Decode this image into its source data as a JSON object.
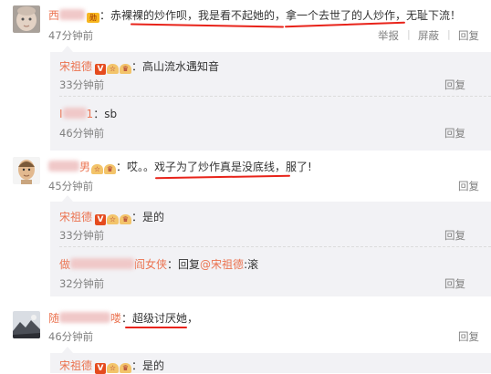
{
  "comments": [
    {
      "user_prefix": "西",
      "user_suffix": "",
      "text": "：赤裸裸的炒作呗，我是看不起她的，拿一个去世了的人炒作，无耻下流！",
      "time": "47分钟前",
      "actions": [
        "举报",
        "屏蔽",
        "回复"
      ]
    },
    {
      "user_prefix": "",
      "user_suffix": "男",
      "text": "：哎。。戏子为了炒作真是没底线，服了!",
      "time": "45分钟前",
      "actions": [
        "回复"
      ]
    },
    {
      "user_prefix": "随",
      "user_suffix": "喽",
      "text": "：超级讨厌她，",
      "time": "46分钟前",
      "actions": [
        "回复"
      ]
    }
  ],
  "replies": [
    {
      "user": "宋祖德",
      "text": "：高山流水遇知音",
      "time": "33分钟前",
      "action": "回复"
    },
    {
      "user_prefix": "I",
      "user_suffix": "1",
      "text": "：sb",
      "time": "46分钟前",
      "action": "回复"
    },
    {
      "user": "宋祖德",
      "text": "：是的",
      "time": "33分钟前",
      "action": "回复"
    },
    {
      "user_prefix": "做",
      "user_suffix": "阎女侠",
      "text_pre": "：回复",
      "mention": "@宋祖德",
      "text_post": ":滚",
      "time": "32分钟前",
      "action": "回复"
    },
    {
      "user": "宋祖德",
      "text": "：是的"
    }
  ],
  "badges": {
    "verified": "V",
    "vip": "VIP"
  },
  "colors": {
    "username": "#eb7350",
    "underline": "#e8231a",
    "reply_bg": "#f2f2f5",
    "meta": "#808080"
  },
  "icons": [
    "avatar-baby",
    "avatar-bald-man",
    "avatar-landscape"
  ]
}
